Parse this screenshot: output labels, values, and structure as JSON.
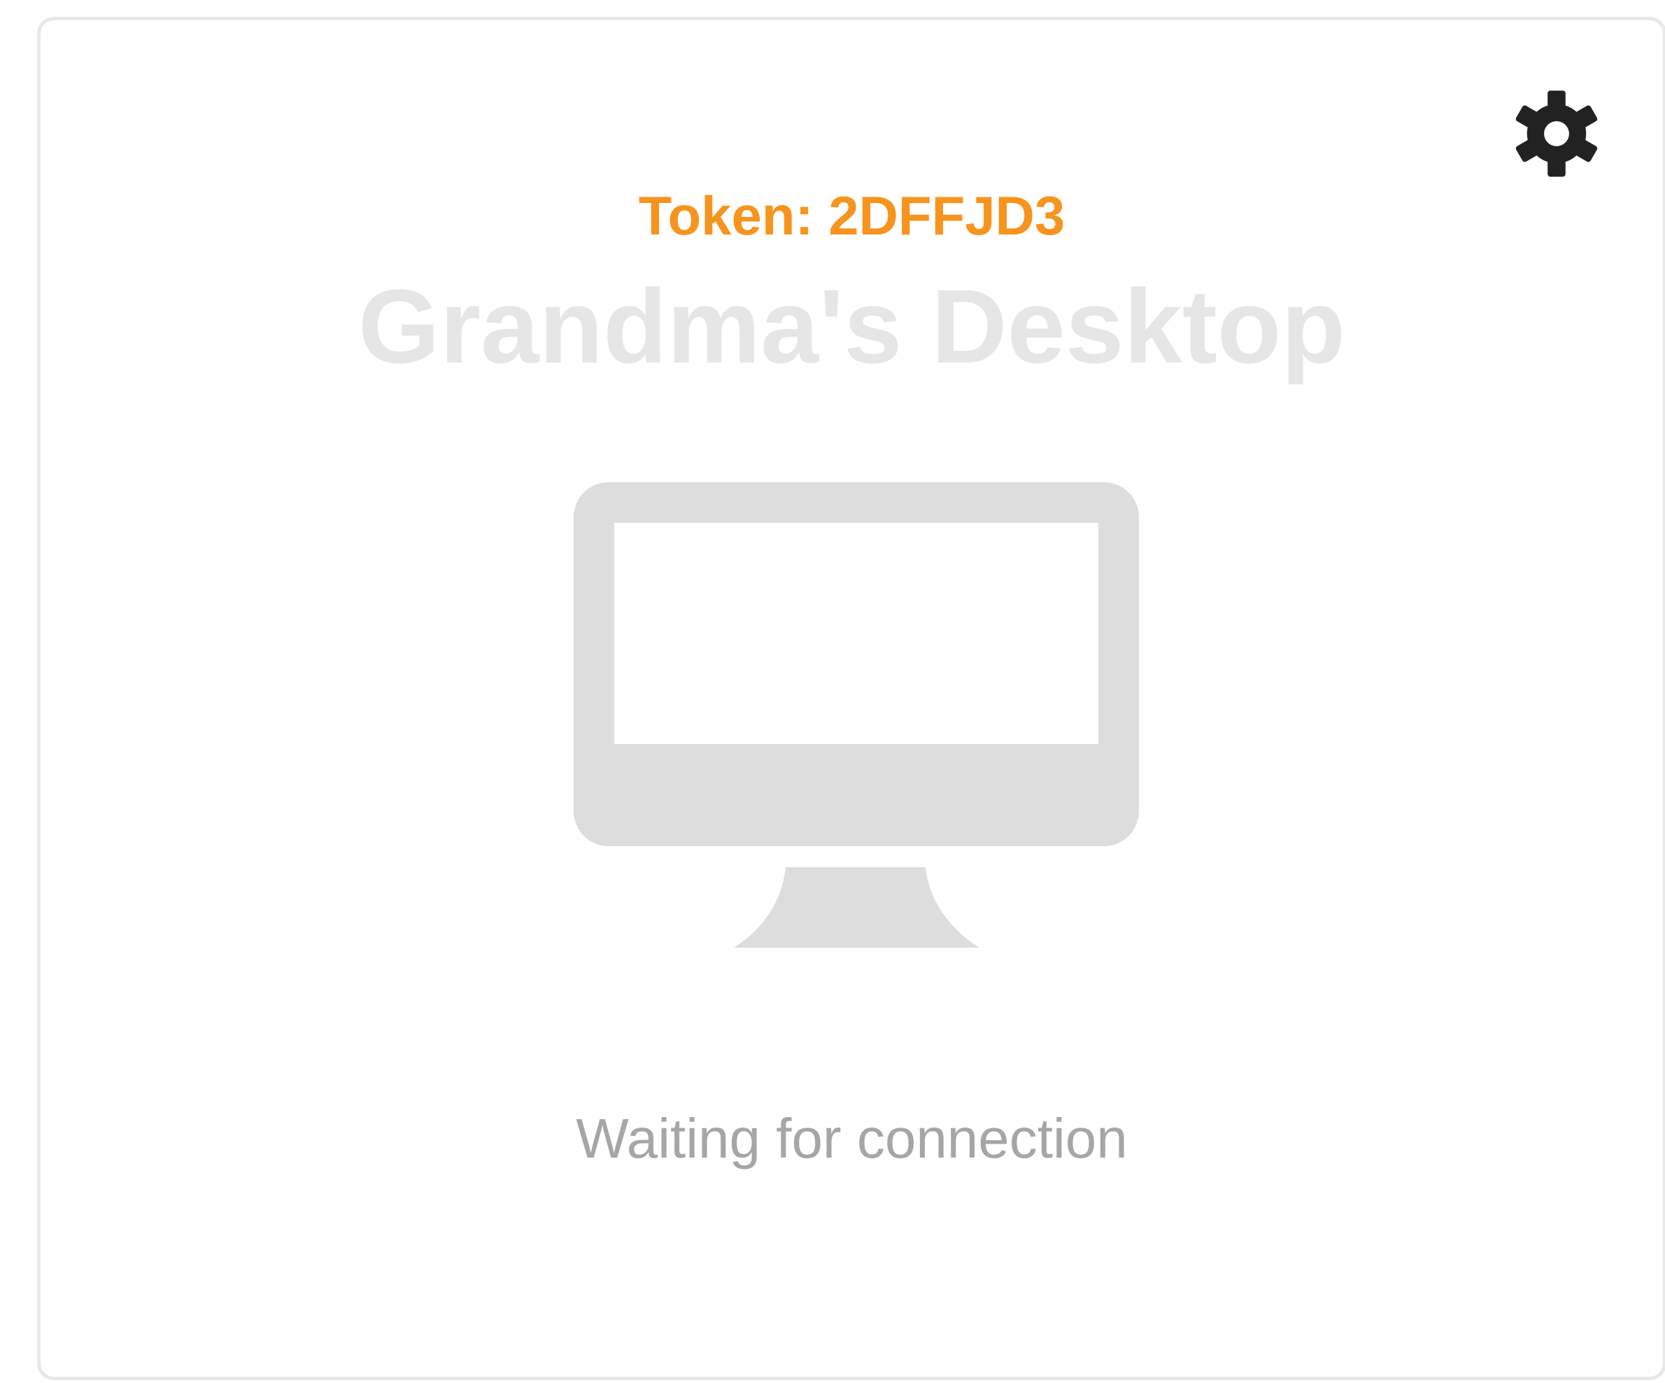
{
  "card": {
    "token_text": "Token: 2DFFJD3",
    "title": "Grandma's Desktop",
    "status": "Waiting for connection",
    "settings_icon": "gear-icon",
    "device_icon": "desktop-monitor-icon"
  },
  "colors": {
    "token": "#f7941d",
    "title": "#e6e6e6",
    "status": "#a6a6a6",
    "monitor": "#dddddd",
    "gear": "#222222",
    "card_border": "#e8e8e8"
  }
}
